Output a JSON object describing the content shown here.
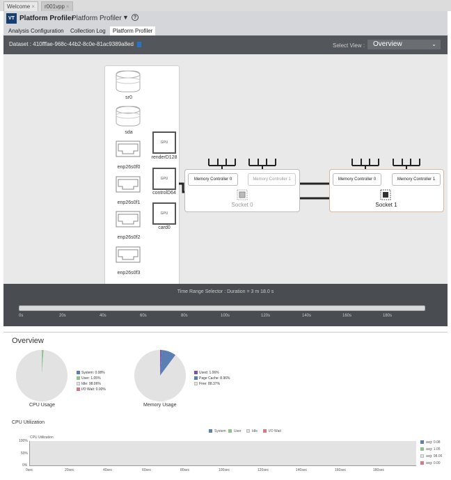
{
  "doc_tabs": [
    {
      "label": "Welcome",
      "close": "×"
    },
    {
      "label": "r001vpp",
      "close": "×"
    }
  ],
  "header": {
    "logo": "VT",
    "product": "Platform Profiler",
    "profiler_select": "Platform Profiler",
    "help": "?"
  },
  "tabs": [
    "Analysis Configuration",
    "Collection Log",
    "Platform Profiler"
  ],
  "dataset": {
    "label": "Dataset : 410fffae-968c-44b2-8c0e-81ac9389a8ed",
    "select_view_label": "Select View :",
    "select_view_value": "Overview"
  },
  "devices": {
    "disks": [
      "sr0",
      "sda"
    ],
    "nics": [
      "enp26s0f0",
      "enp26s0f1",
      "enp26s0f2",
      "enp26s0f3"
    ],
    "gpus": [
      {
        "chip": "GPU",
        "name": "renderD128"
      },
      {
        "chip": "GPU",
        "name": "controlD64"
      },
      {
        "chip": "GPU",
        "name": "card0"
      }
    ]
  },
  "sockets": [
    {
      "name": "Socket 0",
      "controllers": [
        "Memory Controller 0",
        "Memory Controller 1"
      ]
    },
    {
      "name": "Socket 1",
      "controllers": [
        "Memory Controller 0",
        "Memory Controller 1"
      ]
    }
  ],
  "time_range": {
    "label": "Time Range Selector : Duration = 3 m 18.0 s",
    "ticks": [
      "0s",
      "20s",
      "40s",
      "60s",
      "80s",
      "100s",
      "120s",
      "140s",
      "160s",
      "180s"
    ]
  },
  "overview": {
    "title": "Overview",
    "cpu_pie": {
      "label": "CPU Usage",
      "legend": [
        {
          "text": "System: 0.08%",
          "color": "#5b7fb5"
        },
        {
          "text": "User: 1.05%",
          "color": "#8fc18f"
        },
        {
          "text": "Idle: 98.06%",
          "color": "#e2e2e2"
        },
        {
          "text": "I/O Wait: 0.00%",
          "color": "#d57a82"
        }
      ],
      "values": [
        0.08,
        1.05,
        98.06,
        0.0
      ]
    },
    "mem_pie": {
      "label": "Memory Usage",
      "legend": [
        {
          "text": "Used: 1.06%",
          "color": "#7a55a8"
        },
        {
          "text": "Page Cache: 8.96%",
          "color": "#5b7fb5"
        },
        {
          "text": "Free: 88.37%",
          "color": "#e2e2e2"
        }
      ],
      "values": [
        1.06,
        8.96,
        88.37
      ]
    }
  },
  "cpu_utilization": {
    "section_title": "CPU Utilization",
    "chart_title": "CPU Utilization",
    "legend": [
      {
        "text": "System",
        "color": "#5b7fb5"
      },
      {
        "text": "User",
        "color": "#8fc18f"
      },
      {
        "text": "Idle",
        "color": "#e2e2e2"
      },
      {
        "text": "I/O Wait",
        "color": "#d57a82"
      }
    ],
    "y_ticks": [
      "100%",
      "50%",
      "0%"
    ],
    "x_ticks": [
      "0sec",
      "20sec",
      "40sec",
      "60sec",
      "80sec",
      "100sec",
      "120sec",
      "140sec",
      "160sec",
      "180sec"
    ],
    "avg_legend": [
      {
        "text": "avg: 0.08",
        "color": "#5b7fb5"
      },
      {
        "text": "avg: 1.05",
        "color": "#8fc18f"
      },
      {
        "text": "avg: 98.06",
        "color": "#e2e2e2"
      },
      {
        "text": "avg: 0.00",
        "color": "#d57a82"
      }
    ]
  }
}
